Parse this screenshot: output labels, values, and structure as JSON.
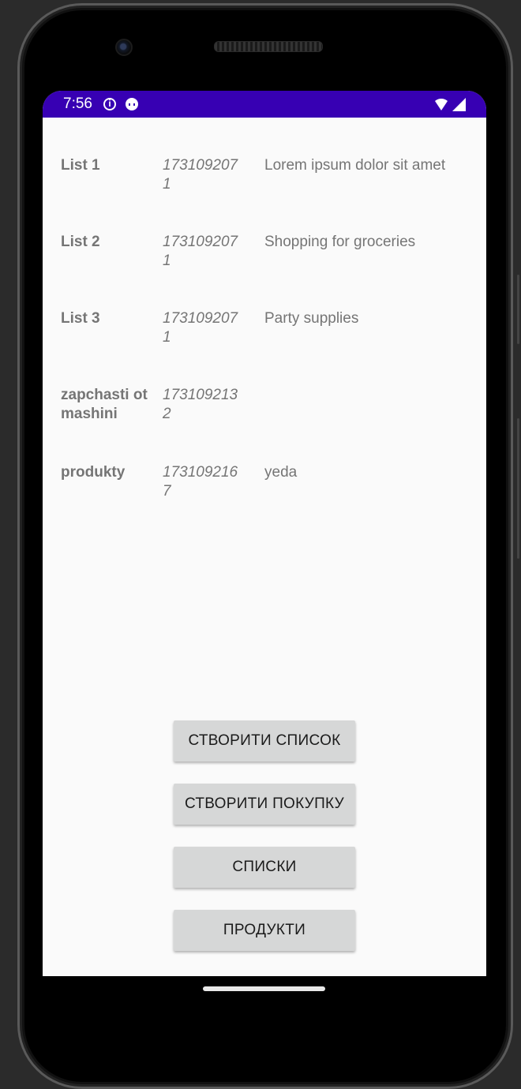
{
  "status_bar": {
    "time": "7:56",
    "icons": [
      "info-icon",
      "android-bot-icon",
      "wifi-icon",
      "signal-icon"
    ],
    "background": "#3700b3"
  },
  "lists": [
    {
      "name": "List 1",
      "date": "1731092071",
      "description": "Lorem ipsum dolor sit amet"
    },
    {
      "name": "List 2",
      "date": "1731092071",
      "description": "Shopping for groceries"
    },
    {
      "name": "List 3",
      "date": "1731092071",
      "description": "Party supplies"
    },
    {
      "name": "zapchasti ot mashini",
      "date": "1731092132",
      "description": ""
    },
    {
      "name": "produkty",
      "date": "1731092167",
      "description": "yeda"
    }
  ],
  "buttons": {
    "create_list": "СТВОРИТИ СПИСОК",
    "create_purchase": "СТВОРИТИ ПОКУПКУ",
    "lists": "СПИСКИ",
    "products": "ПРОДУКТИ"
  },
  "colors": {
    "text_secondary": "#757575",
    "button_bg": "#d6d7d7",
    "screen_bg": "#fafafa"
  }
}
